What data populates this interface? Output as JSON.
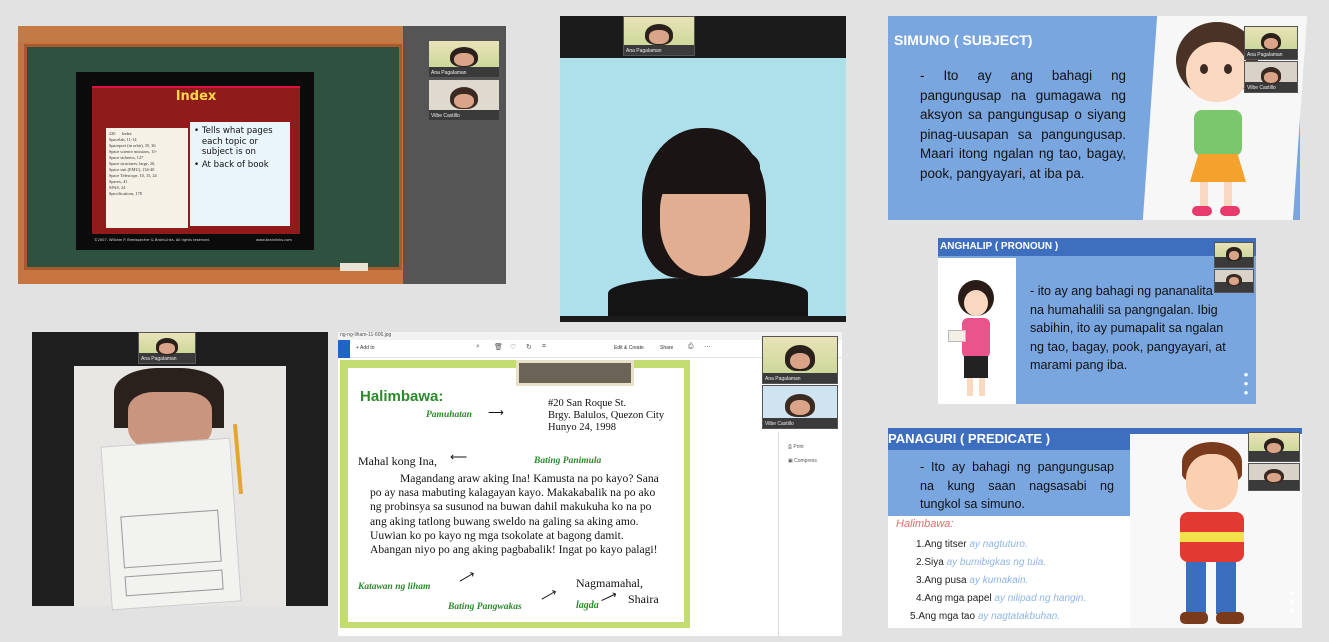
{
  "tile1": {
    "slide_title": "Index",
    "book_page_number": "220",
    "book_page_heading": "Index",
    "book_entries": [
      "Spacelab, 11-14",
      "Spaceport (in orbit), 35, 36",
      "Space science missions, 15-",
      "Space sickness, 127",
      "Space structures, large, 20,",
      "Space suit (EMU), 134-40",
      "Space Telescope, 10, 15, 24",
      "Sparex, 41",
      "SPAS, 24",
      "Specifications, 178"
    ],
    "bullets": [
      "Tells what pages each topic or subject is on",
      "At back of book"
    ],
    "copyright": "©2007. William P. Bredspecher & BrainLinks. All rights reserved.",
    "site": "www.brainlinks.com",
    "participants": [
      "Ana Pagalaman",
      "Vilbe Castillo"
    ]
  },
  "tile2": {
    "participant": "Ana Pagalaman"
  },
  "tile3": {
    "title": "SIMUNO ( SUBJECT)",
    "body": "- Ito ay ang bahagi ng pangungusap na gumagawa ng aksyon sa pangungusap o siyang pinag-uusapan sa pangungusap. Maari itong ngalan ng tao, bagay, pook, pangyayari, at iba pa.",
    "participants": [
      "Ana Pagalaman",
      "Vilbe Castillo"
    ]
  },
  "tile4": {
    "title": "ANGHALIP ( PRONOUN )",
    "body": "- ito ay ang bahagi ng pananalita na humahalili sa pangngalan. Ibig sabihin, ito ay pumapalit sa ngalan ng tao, bagay, pook, pangyayari, at marami pang iba."
  },
  "tile5": {
    "participant": "Ana Pagalaman"
  },
  "tile6": {
    "filename": "ng-ng-liham-11-606.jpg",
    "toolbar": {
      "add_to": "Add to",
      "edit_create": "Edit & Create",
      "share": "Share"
    },
    "side_menu": [
      "Print",
      "Compress"
    ],
    "heading": "Halimbawa:",
    "pamuhatan_label": "Pamuhatan",
    "address": [
      "#20 San Roque St.",
      "Brgy. Balulos, Quezon City",
      "Hunyo 24, 1998"
    ],
    "greeting": "Mahal kong Ina,",
    "greeting_label": "Bating Panimula",
    "body": "Magandang araw aking Ina! Kamusta na po kayo? Sana po ay nasa mabuting kalagayan kayo. Makakabalik na po ako ng probinsya sa susunod na buwan dahil makukuha ko na po ang aking tatlong buwang sweldo na galing sa aking amo. Uuwian ko po kayo ng mga tsokolate at bagong damit. Abangan niyo po ang aking pagbabalik! Ingat po kayo palagi!",
    "body_label": "Katawan ng liham",
    "closing": "Nagmamahal,",
    "closing_label": "Bating Pangwakas",
    "signature": "Shaira",
    "signature_label": "lagda",
    "participants": [
      "Ana Pagalaman",
      "Vilbe Castillo"
    ]
  },
  "tile7": {
    "title": "PANAGURI ( PREDICATE )",
    "body": "- Ito ay bahagi ng pangungusap na kung saan nagsasabi ng tungkol sa simuno.",
    "example_heading": "Halimbawa:",
    "examples": [
      {
        "n": "1.",
        "s": "Ang titser",
        "p": "ay nagtuturo."
      },
      {
        "n": "2.",
        "s": "Siya",
        "p": "ay bumibigkas ng tula."
      },
      {
        "n": "3.",
        "s": "Ang pusa",
        "p": "ay kumakain."
      },
      {
        "n": "4.",
        "s": "Ang mga papel",
        "p": "ay nilipad ng hangin."
      },
      {
        "n": "5.",
        "s": "Ang mga tao",
        "p": "ay nagtatakbuhan."
      }
    ],
    "accent": "#e36b6b"
  },
  "colors": {
    "slide_blue": "#7aa6e0",
    "chalk_green": "#2f5240",
    "wood": "#c7743f"
  }
}
